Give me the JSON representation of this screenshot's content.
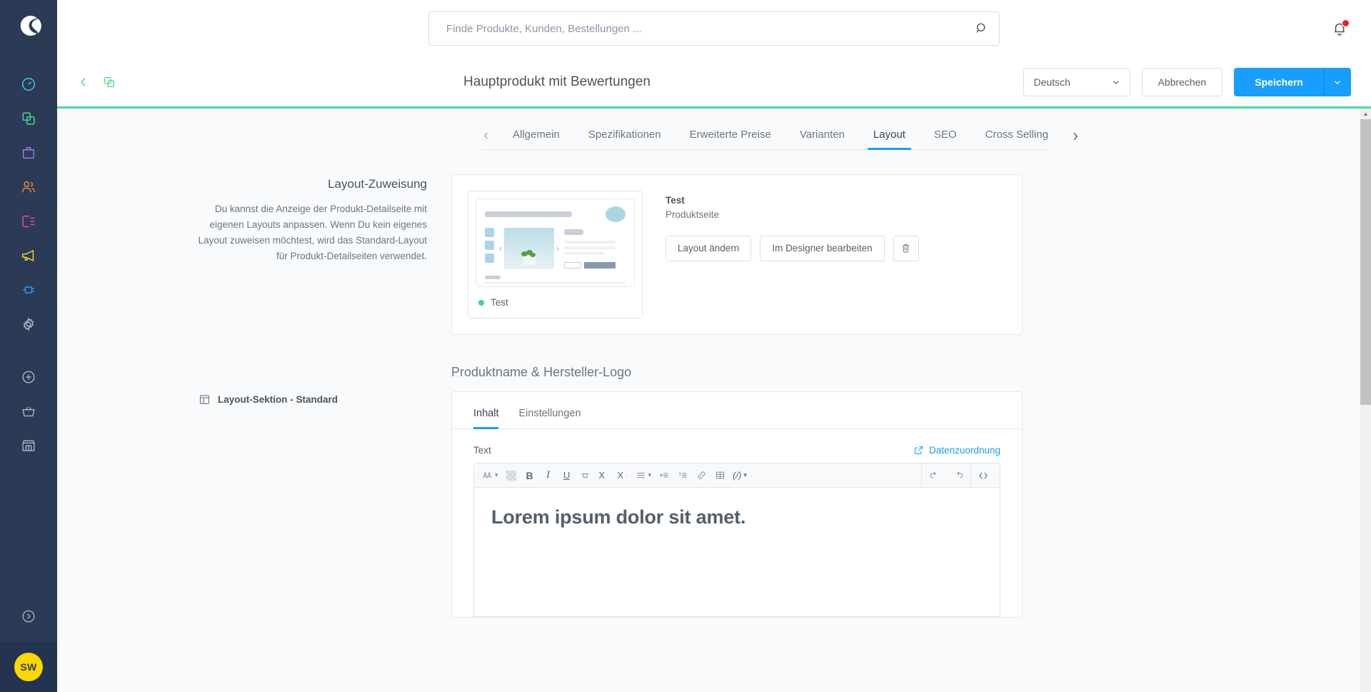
{
  "sidebar": {
    "logo_name": "shopware-logo",
    "items": [
      {
        "name": "dashboard",
        "icon": "gauge-icon",
        "color": "#3ec9ea"
      },
      {
        "name": "catalogues",
        "icon": "copy-icon",
        "color": "#4fd58a"
      },
      {
        "name": "orders",
        "icon": "bag-icon",
        "color": "#9b7bf0"
      },
      {
        "name": "customers",
        "icon": "users-icon",
        "color": "#f08b3a"
      },
      {
        "name": "content",
        "icon": "content-icon",
        "color": "#f0489a"
      },
      {
        "name": "marketing",
        "icon": "megaphone-icon",
        "color": "#f5d327"
      },
      {
        "name": "extensions",
        "icon": "plug-icon",
        "color": "#2f9bf5"
      },
      {
        "name": "settings",
        "icon": "gear-icon",
        "color": "#aeb9c4"
      }
    ],
    "secondary_items": [
      {
        "name": "add",
        "icon": "plus-circle-icon",
        "color": "#aeb9c4"
      },
      {
        "name": "shopping-basket",
        "icon": "basket-icon",
        "color": "#aeb9c4"
      },
      {
        "name": "storefront",
        "icon": "store-icon",
        "color": "#aeb9c4"
      }
    ],
    "collapse": {
      "name": "collapse-sidebar",
      "icon": "chevron-right-circle-icon"
    },
    "avatar_initials": "SW"
  },
  "header": {
    "search_placeholder": "Finde Produkte, Kunden, Bestellungen ...",
    "search_value": "",
    "search_icon": "search-icon",
    "notification_icon": "bell-icon",
    "notification_badge": true
  },
  "toolbar": {
    "back_icon": "chevron-left-icon",
    "duplicate_icon": "copy-icon",
    "title": "Hauptprodukt mit Bewertungen",
    "language": "Deutsch",
    "language_caret": "chevron-down-icon",
    "cancel_label": "Abbrechen",
    "save_label": "Speichern",
    "save_caret": "chevron-down-icon"
  },
  "tabs": {
    "prev_icon": "chevron-left-icon",
    "next_icon": "chevron-right-icon",
    "items": [
      {
        "label": "Allgemein",
        "active": false
      },
      {
        "label": "Spezifikationen",
        "active": false
      },
      {
        "label": "Erweiterte Preise",
        "active": false
      },
      {
        "label": "Varianten",
        "active": false
      },
      {
        "label": "Layout",
        "active": true
      },
      {
        "label": "SEO",
        "active": false
      },
      {
        "label": "Cross Selling",
        "active": false
      }
    ]
  },
  "layout_assignment": {
    "title": "Layout-Zuweisung",
    "description": "Du kannst die Anzeige der Produkt-Detailseite mit eigenen Layouts anpassen. Wenn Du kein eigenes Layout zuweisen möchtest, wird das Standard-Layout für Produkt-Detailseiten verwendet.",
    "preview_label": "Test",
    "preview_status_color": "#37d39a",
    "meta_title": "Test",
    "meta_subtitle": "Produktseite",
    "change_layout_label": "Layout ändern",
    "edit_designer_label": "Im Designer bearbeiten",
    "delete_icon": "trash-icon",
    "thumb_prev_icon": "chevron-left-icon",
    "thumb_next_icon": "chevron-right-icon"
  },
  "layout_section": {
    "aside_icon": "layout-columns-icon",
    "aside_label": "Layout-Sektion - Standard",
    "block_heading": "Produktname & Hersteller-Logo",
    "sub_tabs": [
      {
        "label": "Inhalt",
        "active": true
      },
      {
        "label": "Einstellungen",
        "active": false
      }
    ],
    "field_label": "Text",
    "data_mapping_label": "Datenzuordnung",
    "data_mapping_icon": "external-link-icon",
    "editor_content": "Lorem ipsum dolor sit amet.",
    "rte_tools": [
      {
        "name": "font-style-icon",
        "glyph": "A",
        "caret": true,
        "disabled": false
      },
      {
        "name": "text-color-icon",
        "glyph": "",
        "caret": false,
        "disabled": true
      },
      {
        "name": "bold-icon",
        "glyph": "B",
        "caret": false,
        "disabled": false
      },
      {
        "name": "italic-icon",
        "glyph": "I",
        "caret": false,
        "disabled": false
      },
      {
        "name": "underline-icon",
        "glyph": "U",
        "caret": false,
        "disabled": false
      },
      {
        "name": "strikethrough-icon",
        "glyph": "S",
        "caret": false,
        "disabled": false
      },
      {
        "name": "superscript-icon",
        "glyph": "X",
        "caret": false,
        "disabled": false
      },
      {
        "name": "subscript-icon",
        "glyph": "X",
        "caret": false,
        "disabled": false
      },
      {
        "name": "align-icon",
        "glyph": "",
        "caret": true,
        "disabled": false
      },
      {
        "name": "bullet-list-icon",
        "glyph": "",
        "caret": false,
        "disabled": false
      },
      {
        "name": "numbered-list-icon",
        "glyph": "",
        "caret": false,
        "disabled": false
      },
      {
        "name": "link-icon",
        "glyph": "",
        "caret": false,
        "disabled": false
      },
      {
        "name": "table-icon",
        "glyph": "",
        "caret": false,
        "disabled": false
      },
      {
        "name": "code-inline-icon",
        "glyph": "",
        "caret": true,
        "disabled": false
      }
    ],
    "rte_tools_right": [
      {
        "name": "undo-icon"
      },
      {
        "name": "redo-icon"
      },
      {
        "name": "source-code-icon"
      }
    ]
  },
  "colors": {
    "accent_blue": "#189eff",
    "accent_green": "#4ddba4",
    "sidebar_bg": "#2b3a55",
    "avatar_bg": "#ffd700"
  }
}
